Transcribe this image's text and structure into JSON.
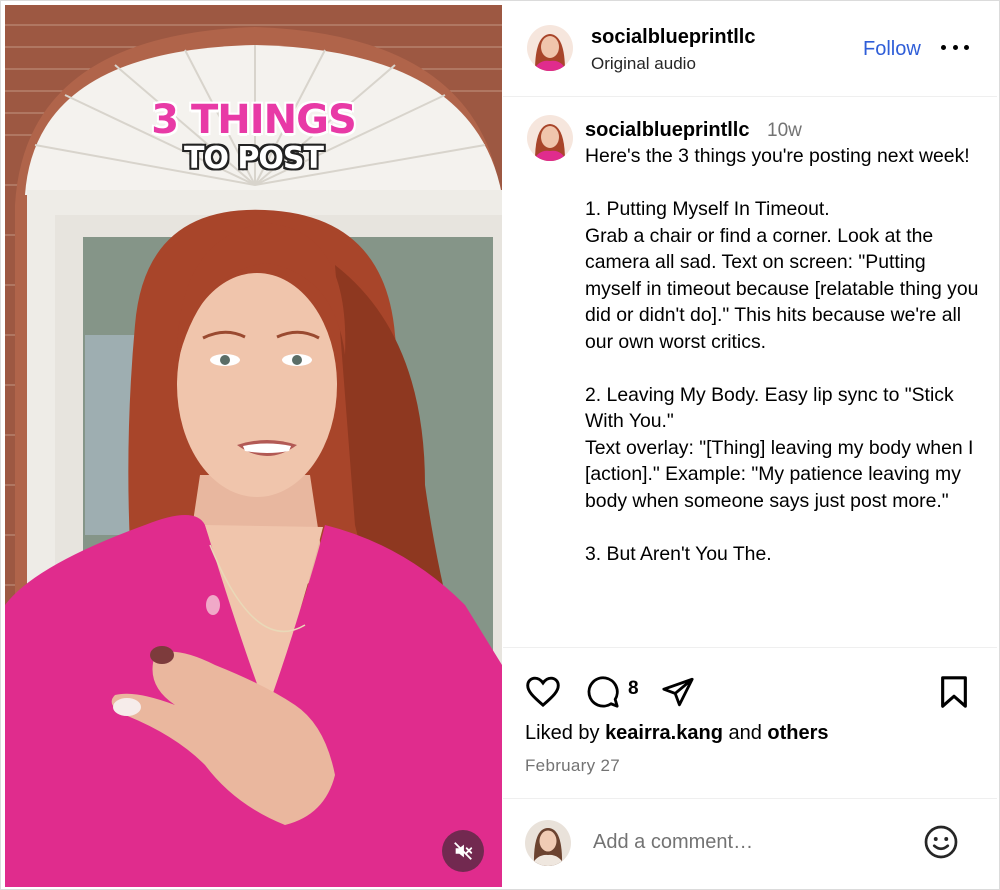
{
  "video": {
    "overlay_line1": "3 THINGS",
    "overlay_line2": "TO POST",
    "mute_icon": "speaker-muted-icon"
  },
  "header": {
    "username": "socialblueprintllc",
    "audio": "Original audio",
    "follow_label": "Follow",
    "more_icon": "more-horizontal-icon"
  },
  "caption": {
    "username": "socialblueprintllc",
    "time": "10w",
    "text": "Here's the 3 things you're posting next week!\n\n1. Putting Myself In Timeout.\nGrab a chair or find a corner. Look at the camera all sad. Text on screen: \"Putting myself in timeout because [relatable thing you did or didn't do].\" This hits because we're all our own worst critics.\n\n2. Leaving My Body. Easy lip sync to \"Stick With You.\"\nText overlay: \"[Thing] leaving my body when I [action].\" Example: \"My patience leaving my body when someone says just post more.\"\n\n3. But Aren't You The."
  },
  "actions": {
    "icons": [
      "heart-icon",
      "comment-icon",
      "share-icon",
      "bookmark-icon"
    ],
    "comment_count": "8",
    "liked_prefix": "Liked by ",
    "liked_user": "keairra.kang",
    "liked_mid": " and ",
    "liked_others": "others",
    "date": "February 27"
  },
  "comment_box": {
    "placeholder": "Add a comment…",
    "emoji_icon": "emoji-icon"
  },
  "colors": {
    "follow": "#2f5ed8",
    "overlay_pink": "#e83aa6",
    "shirt_pink": "#e02c8d",
    "hair": "#a8452a"
  }
}
